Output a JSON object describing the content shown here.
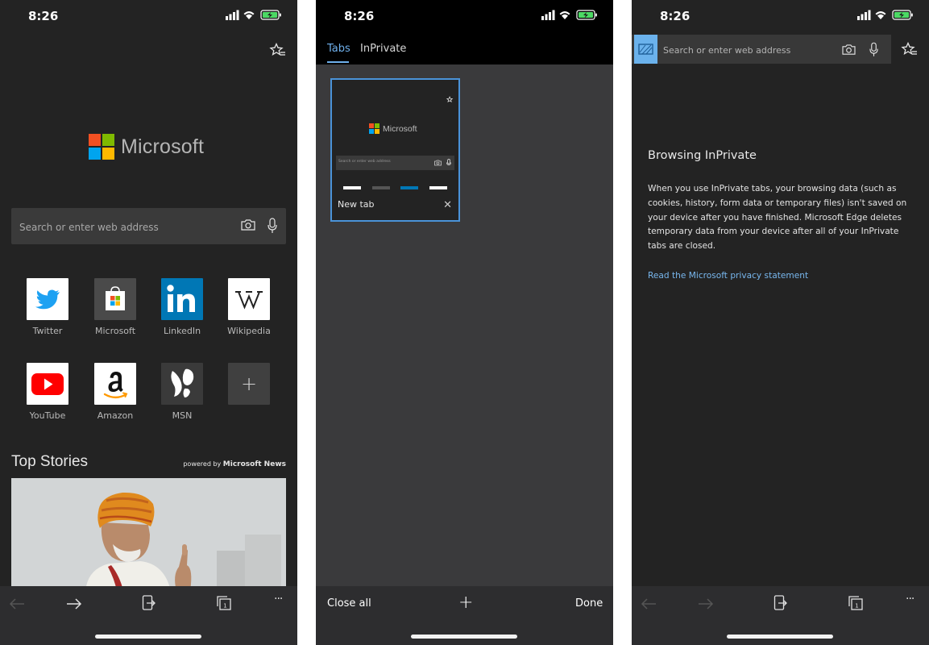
{
  "status": {
    "time": "8:26"
  },
  "phone1": {
    "logo_word": "Microsoft",
    "search": {
      "placeholder": "Search or enter web address"
    },
    "tiles": [
      {
        "label": "Twitter"
      },
      {
        "label": "Microsoft"
      },
      {
        "label": "LinkedIn"
      },
      {
        "label": "Wikipedia"
      },
      {
        "label": "YouTube"
      },
      {
        "label": "Amazon"
      },
      {
        "label": "MSN"
      }
    ],
    "add_tile_glyph": "+",
    "top_stories": "Top Stories",
    "powered_prefix": "powered by",
    "powered_brand": "Microsoft News"
  },
  "phone2": {
    "tabs": [
      {
        "label": "Tabs"
      },
      {
        "label": "InPrivate"
      }
    ],
    "card": {
      "title": "New tab",
      "close_glyph": "✕",
      "thumb_logo": "Microsoft",
      "thumb_search": "Search or enter web address"
    },
    "bottom": {
      "close_all": "Close all",
      "add": "+",
      "done": "Done"
    }
  },
  "phone3": {
    "search": {
      "placeholder": "Search or enter web address"
    },
    "title": "Browsing InPrivate",
    "body": "When you use InPrivate tabs, your browsing data (such as cookies, history, form data or temporary files) isn't saved on your device after you have finished. Microsoft Edge deletes temporary data from your device after all of your InPrivate tabs are closed.",
    "link": "Read the Microsoft privacy statement"
  },
  "toolbar": {
    "more_glyph": "···"
  },
  "colors": {
    "accent": "#6fb0ec",
    "ms_red": "#f25022",
    "ms_green": "#7fba00",
    "ms_blue": "#00a4ef",
    "ms_yellow": "#ffb900"
  }
}
